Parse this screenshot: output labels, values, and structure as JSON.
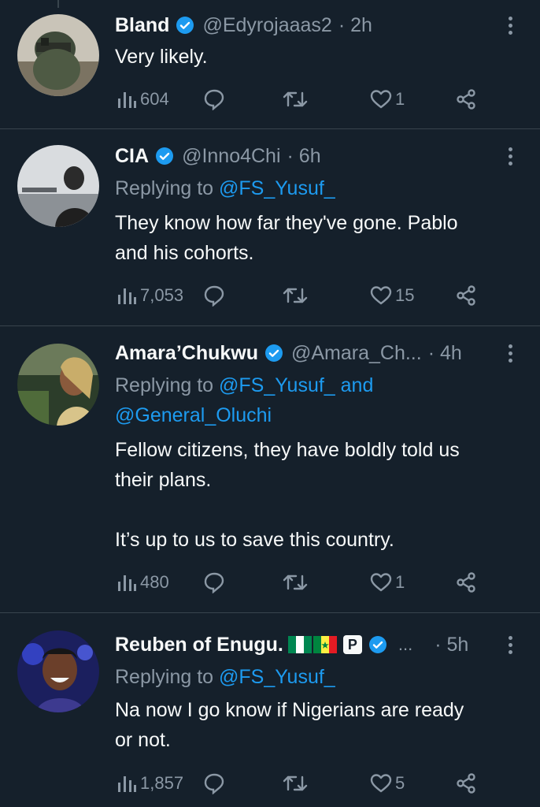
{
  "colors": {
    "background": "#15202b",
    "text": "#f7f9f9",
    "muted": "#8b98a5",
    "link": "#1d9bf0",
    "divider": "#38444d"
  },
  "tweets": [
    {
      "name": "Bland",
      "handle": "@Edyrojaaas2",
      "time": "· 2h",
      "reply_prefix": "",
      "reply_mentions": "",
      "text": "Very likely.",
      "views": "604",
      "retweets": "",
      "likes": "1"
    },
    {
      "name": "CIA",
      "handle": "@Inno4Chi",
      "time": "· 6h",
      "reply_prefix": "Replying to ",
      "reply_mentions": "@FS_Yusuf_",
      "text": "They know how far they've gone. Pablo\nand his cohorts.",
      "views": "7,053",
      "retweets": "",
      "likes": "15"
    },
    {
      "name": "Amara’Chukwu",
      "handle": "@Amara_Ch...",
      "time": "· 4h",
      "reply_prefix": "Replying to ",
      "reply_mentions": "@FS_Yusuf_ and",
      "reply_mentions_line2": "@General_Oluchi",
      "text": "Fellow citizens, they have boldly told us\ntheir plans.\n\nIt’s up to us to save this country.",
      "views": "480",
      "retweets": "",
      "likes": "1"
    },
    {
      "name": "Reuben of Enugu.",
      "handle": "...",
      "time": "· 5h",
      "badge": "P",
      "reply_prefix": "Replying to ",
      "reply_mentions": "@FS_Yusuf_",
      "text": "Na now I go know if Nigerians are ready\nor not.",
      "views": "1,857",
      "retweets": "",
      "likes": "5"
    }
  ]
}
